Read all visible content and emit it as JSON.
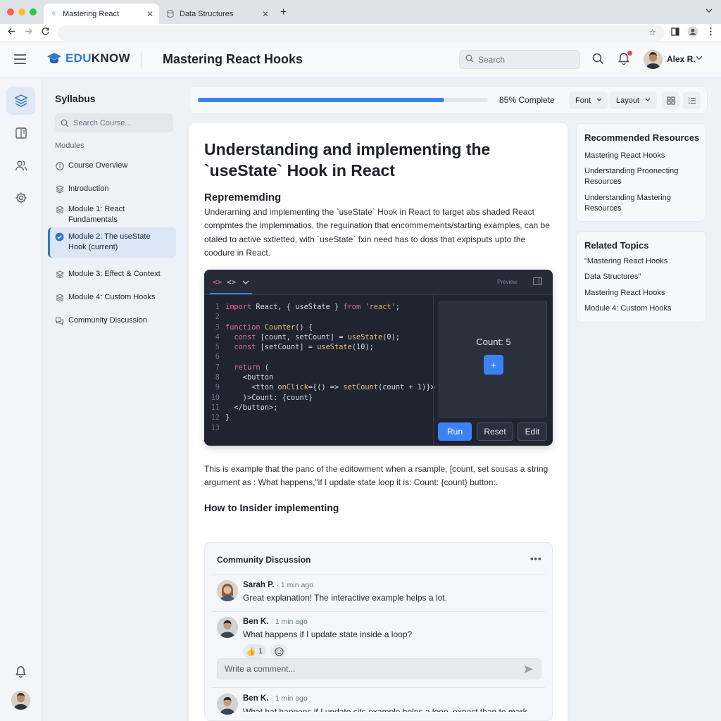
{
  "browser": {
    "tabs": [
      {
        "label": "Mastering React",
        "active": true
      },
      {
        "label": "Data Structures",
        "active": false
      }
    ]
  },
  "header": {
    "logo_prefix": "EDU",
    "logo_suffix": "KNOW",
    "course_title": "Mastering React Hooks",
    "search_placeholder": "Search",
    "user_name": "Alex R."
  },
  "syllabus": {
    "title": "Syllabus",
    "search_placeholder": "Search Course...",
    "section_label": "Modules",
    "items": [
      {
        "label": "Course Overview",
        "icon": "info-icon"
      },
      {
        "label": "Introduction",
        "icon": "layers-icon"
      },
      {
        "label": "Module 1: React Fundamentals",
        "icon": "layers-icon"
      },
      {
        "label": "Module 2: The useState Hook (current)",
        "icon": "check-circle-icon",
        "current": true
      },
      {
        "label": "Module 3: Effect & Context",
        "icon": "layers-icon"
      },
      {
        "label": "Module 4: Custom Hooks",
        "icon": "layers-icon"
      },
      {
        "label": "Community Discussion",
        "icon": "chat-icon"
      }
    ]
  },
  "toolbar": {
    "progress_percent": 85,
    "progress_text": "85% Complete",
    "font_label": "Font",
    "layout_label": "Layout"
  },
  "article": {
    "title": "Understanding and implementing the `useState` Hook in React",
    "subheading": "Reprememding",
    "paragraph": "Underarning and implementing the `useState` Hook in React to target abs shaded React compmtes the implemmatios, the reguination that encommements/starting examples, can be otaled to active sxtietted, with `useState` fxin need has to doss that expisputs upto the coodure in React.",
    "paragraph2": "This is example that the panc of the editowment when a rsample, [count, set sousas a string argument as : What happens,\"if I update state loop it is: Count: {count} button:.",
    "heading2": "How to Insider implementing"
  },
  "editor": {
    "preview_label": "Preview",
    "lines": [
      {
        "n": "1",
        "tokens": [
          [
            "kw",
            "import"
          ],
          [
            "tx",
            " React, { useState } "
          ],
          [
            "kw",
            "from"
          ],
          [
            "tx",
            " "
          ],
          [
            "str",
            "'react'"
          ],
          [
            "tx",
            ";"
          ]
        ]
      },
      {
        "n": "2",
        "tokens": []
      },
      {
        "n": "3",
        "tokens": [
          [
            "kw",
            "function"
          ],
          [
            "tx",
            " "
          ],
          [
            "fn",
            "Counter"
          ],
          [
            "tx",
            "() {"
          ]
        ]
      },
      {
        "n": "4",
        "tokens": [
          [
            "tx",
            "  "
          ],
          [
            "kw",
            "const"
          ],
          [
            "tx",
            " [count, setCount] = "
          ],
          [
            "fn",
            "useState"
          ],
          [
            "tx",
            "(0);"
          ]
        ]
      },
      {
        "n": "5",
        "tokens": [
          [
            "tx",
            "  "
          ],
          [
            "kw",
            "const"
          ],
          [
            "tx",
            " [setCount] = "
          ],
          [
            "fn",
            "useState"
          ],
          [
            "tx",
            "(10);"
          ]
        ]
      },
      {
        "n": "6",
        "tokens": []
      },
      {
        "n": "7",
        "tokens": [
          [
            "tx",
            "  "
          ],
          [
            "kw",
            "return"
          ],
          [
            "tx",
            " ("
          ]
        ]
      },
      {
        "n": "8",
        "tokens": [
          [
            "tx",
            "    <button"
          ]
        ]
      },
      {
        "n": "9",
        "tokens": [
          [
            "tx",
            "      <tton "
          ],
          [
            "fn",
            "onClick"
          ],
          [
            "tx",
            "={() => "
          ],
          [
            "fn",
            "setCount"
          ],
          [
            "tx",
            "(count + 1)}>"
          ]
        ]
      },
      {
        "n": "10",
        "tokens": [
          [
            "tx",
            "    )>Count: {count}"
          ]
        ]
      },
      {
        "n": "11",
        "tokens": [
          [
            "tx",
            "  </button>;"
          ]
        ]
      },
      {
        "n": "12",
        "tokens": [
          [
            "tx",
            "}"
          ]
        ]
      },
      {
        "n": "13",
        "tokens": []
      }
    ],
    "preview_count": "Count: 5",
    "plus_label": "+",
    "run_label": "Run",
    "reset_label": "Reset",
    "edit_label": "Edit"
  },
  "discussion": {
    "title": "Community Discussion",
    "more_label": "•••",
    "comments": [
      {
        "name": "Sarah P.",
        "time": " · 1 min ago",
        "text": "Great explanation! The interactive example helps a lot."
      },
      {
        "name": "Ben K.",
        "time": " · 1 min ago",
        "text": "What happens if I update state inside a loop?",
        "likes": "1"
      },
      {
        "name": "Ben K.",
        "time": " · 1 min ago",
        "text": "What hat happens if I update sits example helps a loop, expect than to mark"
      }
    ],
    "comment_placeholder": "Write a comment..."
  },
  "resources": {
    "title": "Recommended Resources",
    "links": [
      "Mastering React Hooks",
      "Understanding Proonecting Resources",
      "Understanding Mastering Resources"
    ]
  },
  "related": {
    "title": "Related Topics",
    "links": [
      "\"Mastering React Hooks",
      "Data Structures\"",
      "Mastering React Hooks",
      "Module 4: Custom Hooks"
    ]
  },
  "colors": {
    "accent": "#3b82f6",
    "brand": "#2f78d0",
    "editor_bg": "#1f2430"
  }
}
